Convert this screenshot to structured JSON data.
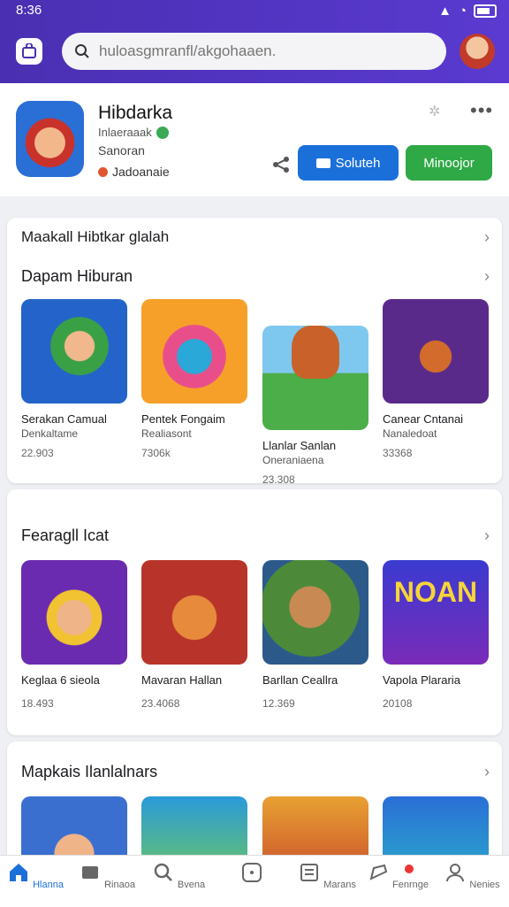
{
  "status": {
    "time": "8:36"
  },
  "search": {
    "placeholder": "huloasgmranfl/akgohaaen."
  },
  "app": {
    "name": "Hibdarka",
    "developer": "Inlaeraaak",
    "subtitle": "Sanoran",
    "rating_text": "Jadoanaie",
    "btn_primary": "Soluteh",
    "btn_secondary": "Minoojor"
  },
  "sections": [
    {
      "top_title": "Maakall Hibtkar glalah",
      "title": "Dapam Hiburan",
      "items": [
        {
          "name": "Serakan Camual",
          "dev": "Denkaltame",
          "count": "22.903"
        },
        {
          "name": "Pentek Fongaim",
          "dev": "Realiasont",
          "count": "7306k"
        },
        {
          "name": "Llanlar Sanlan",
          "dev": "Oneraniaena",
          "count": "23.308"
        },
        {
          "name": "Canear Cntanai",
          "dev": "Nanaledoat",
          "count": "33368"
        }
      ]
    },
    {
      "title": "Fearagll Icat",
      "items": [
        {
          "name": "Keglaa 6 sieola",
          "count": "18.493"
        },
        {
          "name": "Mavaran Hallan",
          "count": "23.4068"
        },
        {
          "name": "Barllan Ceallra",
          "count": "12.369"
        },
        {
          "name": "Vapola Plararia",
          "count": "20108"
        }
      ]
    },
    {
      "title": "Mapkais Ilanlalnars"
    }
  ],
  "nav": [
    {
      "label": "Hlanna",
      "icon": "home-icon"
    },
    {
      "label": "Rinaoa",
      "icon": "games-icon"
    },
    {
      "label": "Bvena",
      "icon": "search-icon"
    },
    {
      "label": "",
      "icon": "apps-icon"
    },
    {
      "label": "Marans",
      "icon": "library-icon"
    },
    {
      "label": "Fenrnge",
      "icon": "notifications-icon"
    },
    {
      "label": "Nenies",
      "icon": "profile-icon"
    }
  ]
}
